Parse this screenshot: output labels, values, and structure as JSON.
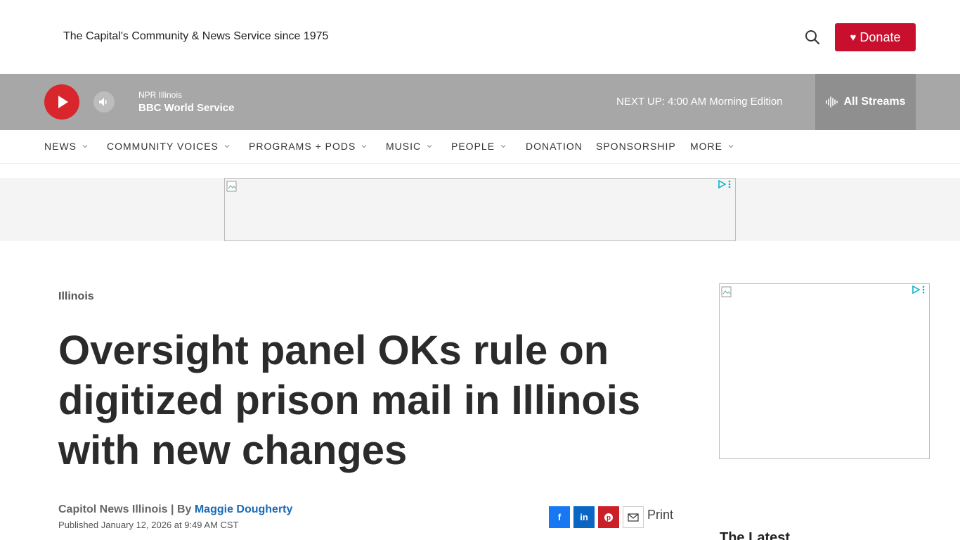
{
  "header": {
    "tagline": "The Capital's Community & News Service since 1975",
    "search_icon": "search-icon",
    "donate_label": "Donate",
    "donate_icon": "heart-icon",
    "donate_color": "#c8102e"
  },
  "player": {
    "station_network": "NPR Illinois",
    "now_playing": "BBC World Service",
    "next_up": "NEXT UP: 4:00 AM Morning Edition",
    "all_streams_label": "All Streams",
    "play_color": "#d8262c",
    "bar_color": "#a7a7a7"
  },
  "nav": {
    "items": [
      {
        "label": "NEWS",
        "has_dropdown": true
      },
      {
        "label": "COMMUNITY VOICES",
        "has_dropdown": true
      },
      {
        "label": "PROGRAMS + PODS",
        "has_dropdown": true
      },
      {
        "label": "MUSIC",
        "has_dropdown": true
      },
      {
        "label": "PEOPLE",
        "has_dropdown": true
      },
      {
        "label": "DONATION",
        "has_dropdown": false
      },
      {
        "label": "SPONSORSHIP",
        "has_dropdown": false
      },
      {
        "label": "MORE",
        "has_dropdown": true
      }
    ]
  },
  "article": {
    "kicker": "Illinois",
    "headline": "Oversight panel OKs rule on digitized prison mail in Illinois with new changes",
    "byline_prefix": "Capitol News Illinois | By ",
    "author": "Maggie Dougherty",
    "published": "Published January 12, 2026 at 9:49 AM CST",
    "share": {
      "facebook": "f",
      "linkedin": "in",
      "pinterest_icon": "pinterest-icon",
      "email_icon": "email-icon",
      "print_label": "Print"
    }
  },
  "sidebar": {
    "latest_heading": "The Latest"
  }
}
